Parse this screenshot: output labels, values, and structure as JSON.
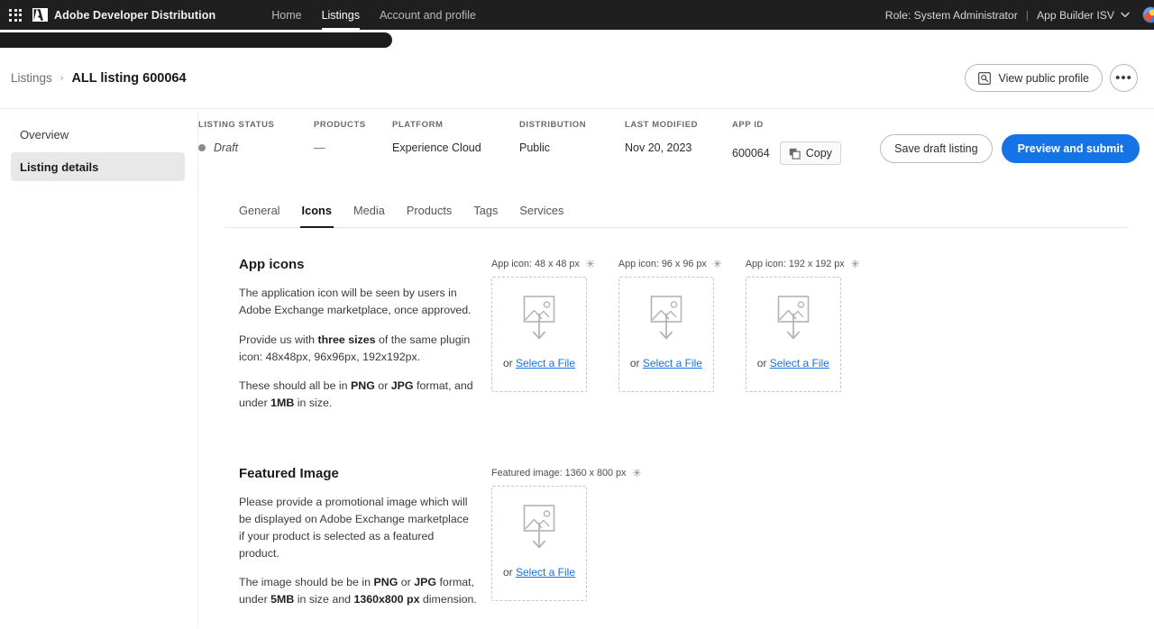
{
  "topnav": {
    "app_grid_icon": "app-grid-icon",
    "brand": "Adobe Developer Distribution",
    "links": [
      {
        "label": "Home",
        "active": false
      },
      {
        "label": "Listings",
        "active": true
      },
      {
        "label": "Account and profile",
        "active": false
      }
    ],
    "role": "Role: System Administrator",
    "separator": "|",
    "org": "App Builder ISV",
    "caret_icon": "chevron-down-icon",
    "avatar_icon": "avatar"
  },
  "breadcrumb": {
    "parent": "Listings",
    "separator": "›",
    "current": "ALL listing 600064",
    "view_public_profile": "View public profile",
    "view_icon": "search-in-box-icon",
    "more_label": "•••"
  },
  "sidebar": {
    "items": [
      {
        "label": "Overview",
        "selected": false
      },
      {
        "label": "Listing details",
        "selected": true
      }
    ]
  },
  "meta": {
    "columns": [
      {
        "label": "LISTING STATUS",
        "value": "Draft"
      },
      {
        "label": "PRODUCTS",
        "value": "—"
      },
      {
        "label": "PLATFORM",
        "value": "Experience Cloud"
      },
      {
        "label": "DISTRIBUTION",
        "value": "Public"
      },
      {
        "label": "LAST MODIFIED",
        "value": "Nov 20, 2023"
      },
      {
        "label": "APP ID",
        "value": "600064"
      }
    ],
    "copy_label": "Copy",
    "copy_icon": "copy-icon",
    "save_draft_label": "Save draft listing",
    "preview_submit_label": "Preview and submit",
    "accent_color": "#1473e6"
  },
  "tabs": [
    {
      "label": "General",
      "active": false
    },
    {
      "label": "Icons",
      "active": true
    },
    {
      "label": "Media",
      "active": false
    },
    {
      "label": "Products",
      "active": false
    },
    {
      "label": "Tags",
      "active": false
    },
    {
      "label": "Services",
      "active": false
    }
  ],
  "app_icons": {
    "title": "App icons",
    "p1": "The application icon will be seen by users in Adobe Exchange marketplace, once approved.",
    "p2_pre": "Provide us with ",
    "p2_b": "three sizes",
    "p2_post": " of the same plugin icon: 48x48px, 96x96px, 192x192px.",
    "p3_pre": "These should all be in ",
    "p3_b1": "PNG",
    "p3_mid": " or ",
    "p3_b2": "JPG",
    "p3_mid2": " format, and under ",
    "p3_b3": "1MB",
    "p3_post": " in size.",
    "drops": [
      {
        "label": "App icon: 48 x 48 px",
        "required": "✳",
        "or": "or",
        "cta": "Select a File",
        "icon": "image-upload-icon"
      },
      {
        "label": "App icon: 96 x 96 px",
        "required": "✳",
        "or": "or",
        "cta": "Select a File",
        "icon": "image-upload-icon"
      },
      {
        "label": "App icon: 192 x 192 px",
        "required": "✳",
        "or": "or",
        "cta": "Select a File",
        "icon": "image-upload-icon"
      }
    ]
  },
  "featured_image": {
    "title": "Featured Image",
    "p1": "Please provide a promotional image which will be displayed on Adobe Exchange marketplace if your product is selected as a featured product.",
    "p2_pre": "The image should be be in ",
    "p2_b1": "PNG",
    "p2_mid": " or ",
    "p2_b2": "JPG",
    "p2_mid2": " format, under ",
    "p2_b3": "5MB",
    "p2_mid3": " in size and ",
    "p2_b4": "1360x800 px",
    "p2_post": " dimension.",
    "drops": [
      {
        "label": "Featured image: 1360 x 800 px",
        "required": "✳",
        "or": "or",
        "cta": "Select a File",
        "icon": "image-upload-icon"
      }
    ]
  }
}
